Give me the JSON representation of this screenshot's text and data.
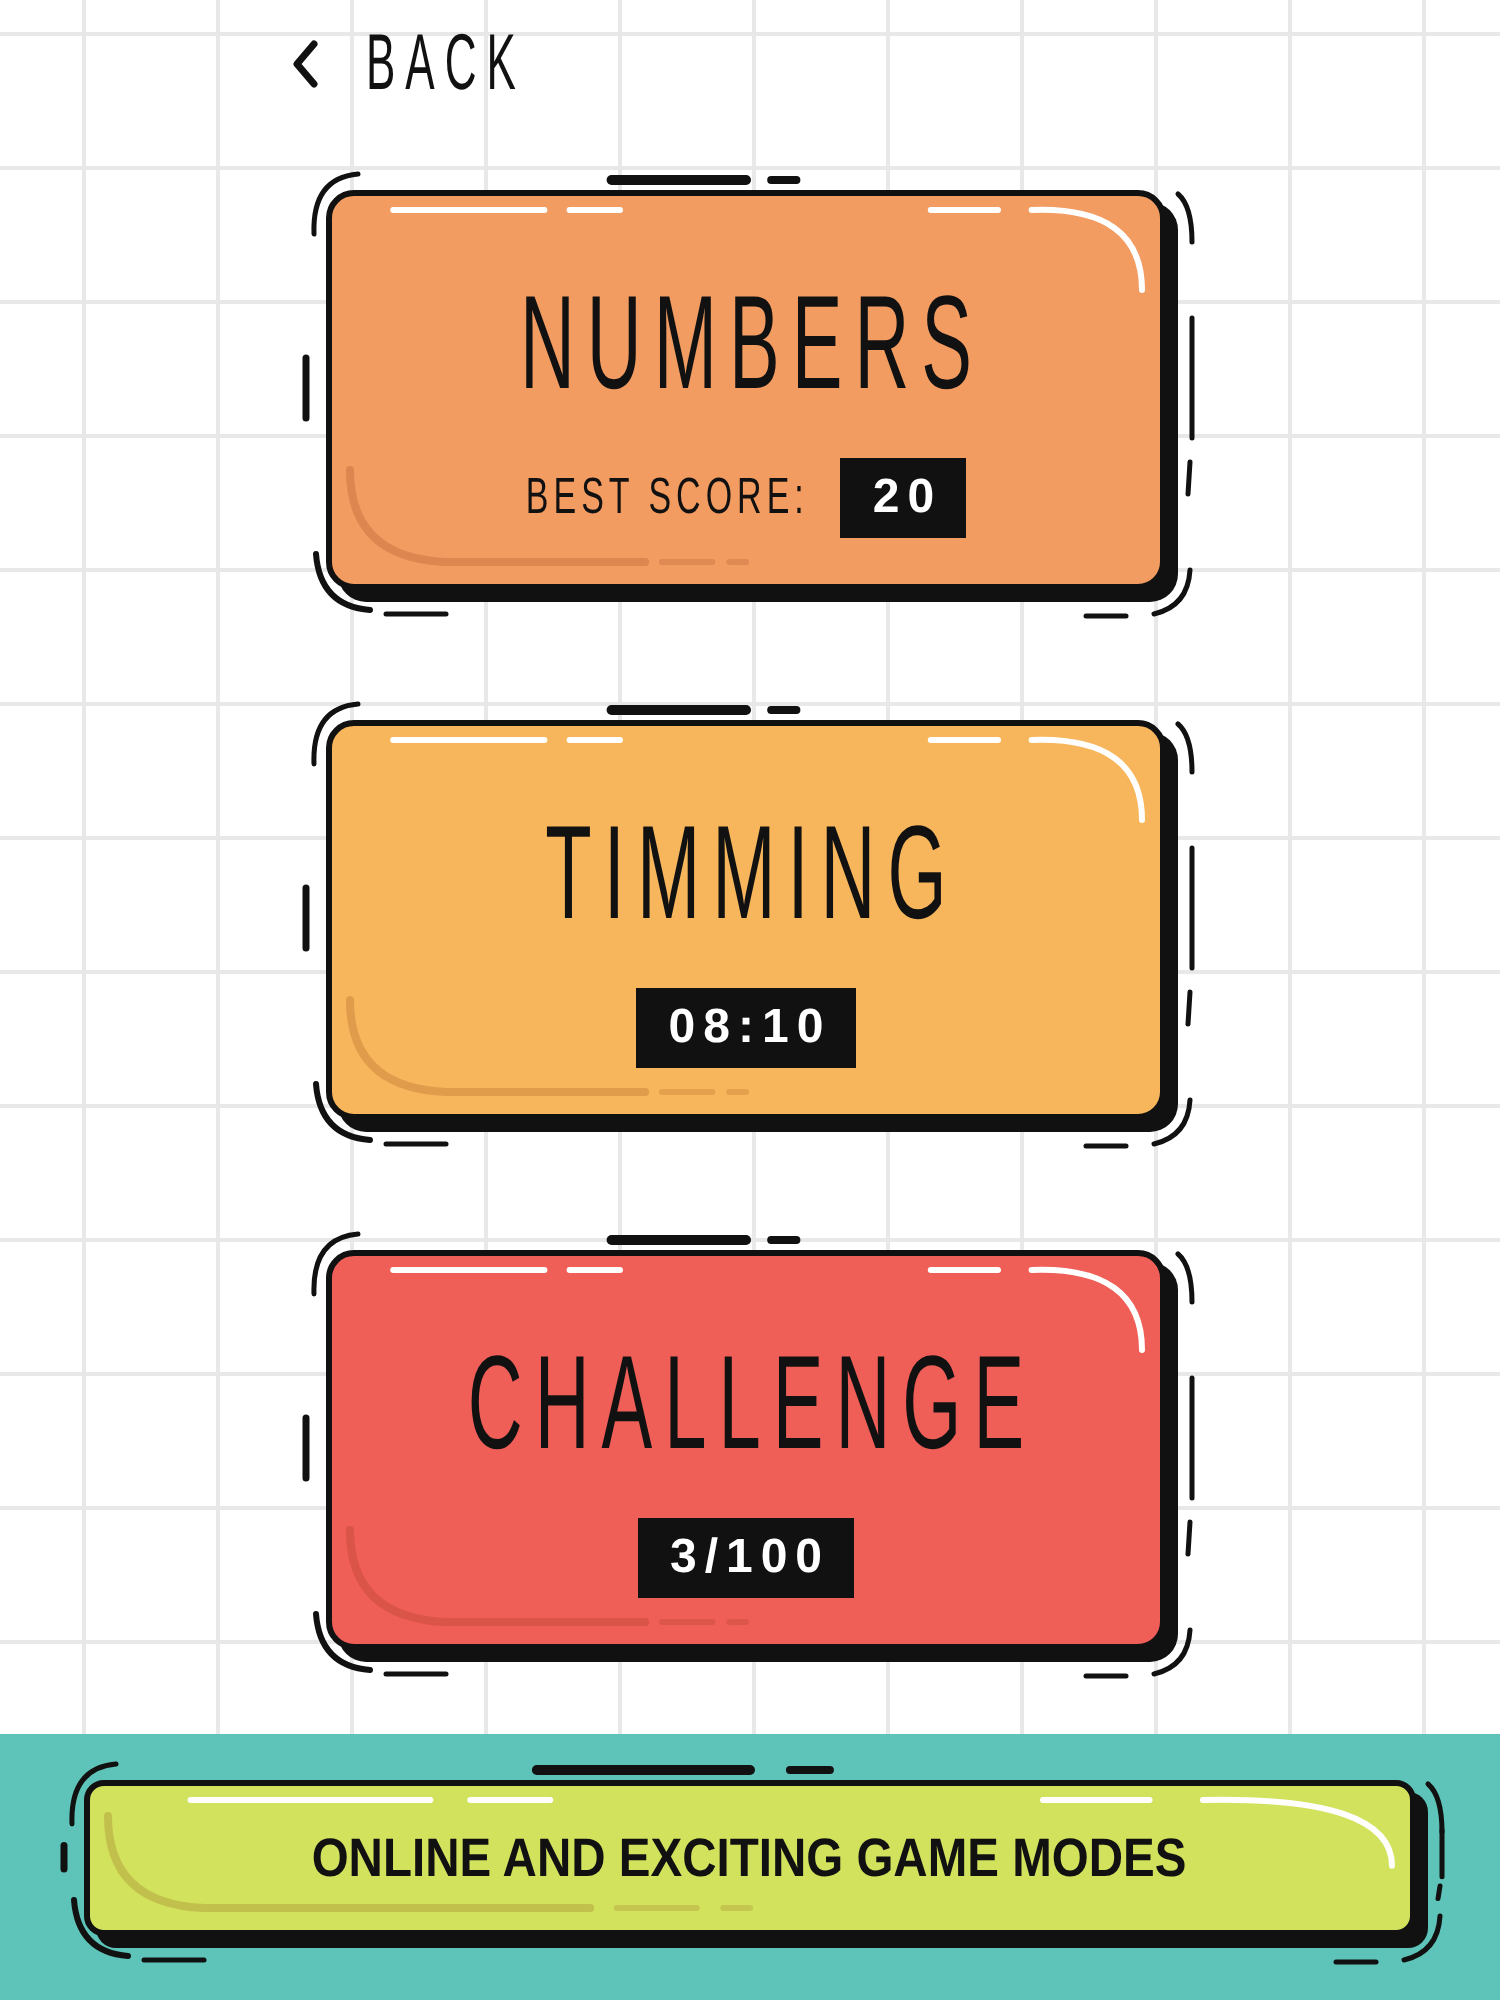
{
  "back": {
    "label": "BACK"
  },
  "modes": [
    {
      "title": "NUMBERS",
      "label": "BEST SCORE:",
      "value": "20",
      "color": "#f39c62"
    },
    {
      "title": "TIMMING",
      "value": "08:10",
      "color": "#f8b65c"
    },
    {
      "title": "CHALLENGE",
      "value": "3/100",
      "color": "#ef5e57"
    }
  ],
  "banner": {
    "text": "ONLINE AND EXCITING GAME MODES"
  }
}
